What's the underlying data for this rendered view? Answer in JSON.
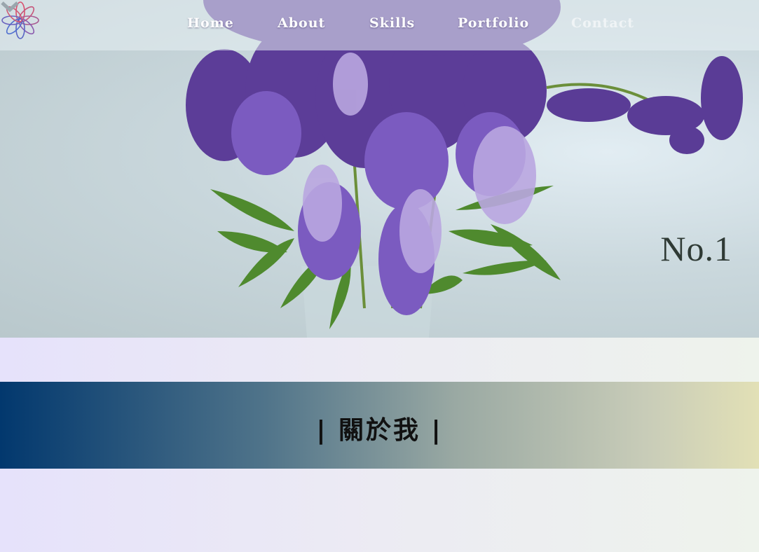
{
  "nav": {
    "logo_icon": "lotus-flower-icon",
    "items": [
      {
        "label": "Home"
      },
      {
        "label": "About"
      },
      {
        "label": "Skills"
      },
      {
        "label": "Portfolio"
      },
      {
        "label": "Contact"
      }
    ]
  },
  "hero": {
    "badge": "No.1",
    "scroll_icon": "chevron-down-icon"
  },
  "about": {
    "title": "| 關於我 |"
  },
  "colors": {
    "band_start": "#02386e",
    "band_end": "#e2e0b6",
    "flower_purple": "#6a4aa8",
    "leaf_green": "#4f8a2e"
  }
}
